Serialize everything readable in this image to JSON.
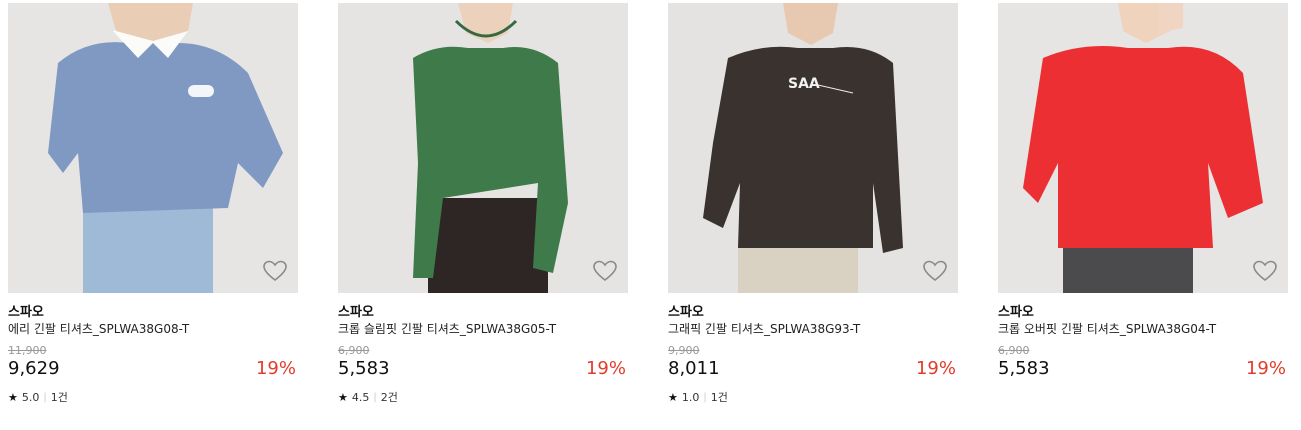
{
  "products": [
    {
      "brand": "스파오",
      "name": "에리 긴팔 티셔츠_SPLWA38G08-T",
      "original_price": "11,900",
      "price": "9,629",
      "discount": "19%",
      "rating": "5.0",
      "reviews": "1건",
      "shirt_color": "#7f99c3",
      "has_rating": true
    },
    {
      "brand": "스파오",
      "name": "크롭 슬림핏 긴팔 티셔츠_SPLWA38G05-T",
      "original_price": "6,900",
      "price": "5,583",
      "discount": "19%",
      "rating": "4.5",
      "reviews": "2건",
      "shirt_color": "#3f7a4b",
      "has_rating": true
    },
    {
      "brand": "스파오",
      "name": "그래픽 긴팔 티셔츠_SPLWA38G93-T",
      "original_price": "9,900",
      "price": "8,011",
      "discount": "19%",
      "rating": "1.0",
      "reviews": "1건",
      "shirt_color": "#3a322e",
      "has_rating": true
    },
    {
      "brand": "스파오",
      "name": "크롭 오버핏 긴팔 티셔츠_SPLWA38G04-T",
      "original_price": "6,900",
      "price": "5,583",
      "discount": "19%",
      "rating": "",
      "reviews": "",
      "shirt_color": "#ec2f33",
      "has_rating": false
    }
  ],
  "icons": {
    "wishlist": "heart-outline-icon",
    "rating": "star-icon"
  },
  "colors": {
    "discount": "#e23b2b",
    "strike": "#999999",
    "background": "#ffffff"
  }
}
